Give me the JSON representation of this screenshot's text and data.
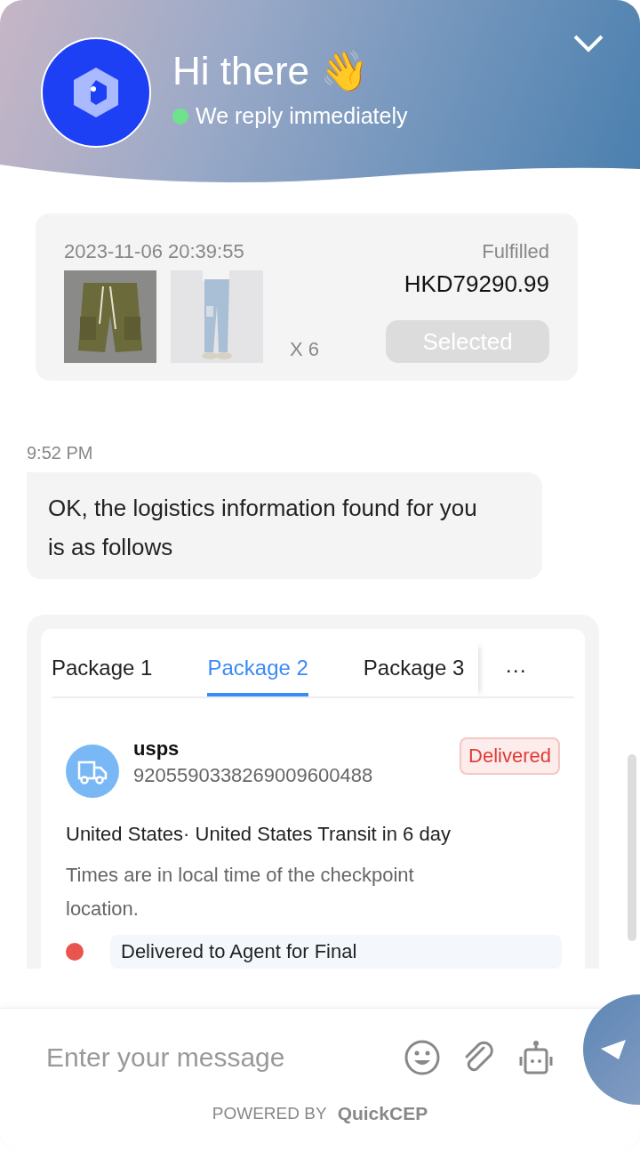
{
  "header": {
    "title": "Hi there 👋",
    "status": "We reply immediately",
    "online": true
  },
  "order": {
    "date": "2023-11-06 20:39:55",
    "status": "Fulfilled",
    "total": "HKD79290.99",
    "quantity": "X 6",
    "button": "Selected"
  },
  "message": {
    "time": "9:52 PM",
    "text": "OK, the logistics information found for you is as follows"
  },
  "tracking": {
    "tabs": [
      {
        "label": "Package 1",
        "selected": false
      },
      {
        "label": "Package 2",
        "selected": true
      },
      {
        "label": "Package 3",
        "selected": false
      }
    ],
    "more": "···",
    "carrier": "usps",
    "number": "9205590338269009600488",
    "badge": "Delivered",
    "route": "United States· United States Transit in 6 day",
    "note": "Times are in local time of the checkpoint location.",
    "checkpoints": [
      {
        "text": "Delivered to Agent for Final",
        "color": "#e8554e"
      }
    ]
  },
  "composer": {
    "placeholder": "Enter your message"
  },
  "footer": {
    "powered": "POWERED BY",
    "brand": "QuickCEP"
  }
}
